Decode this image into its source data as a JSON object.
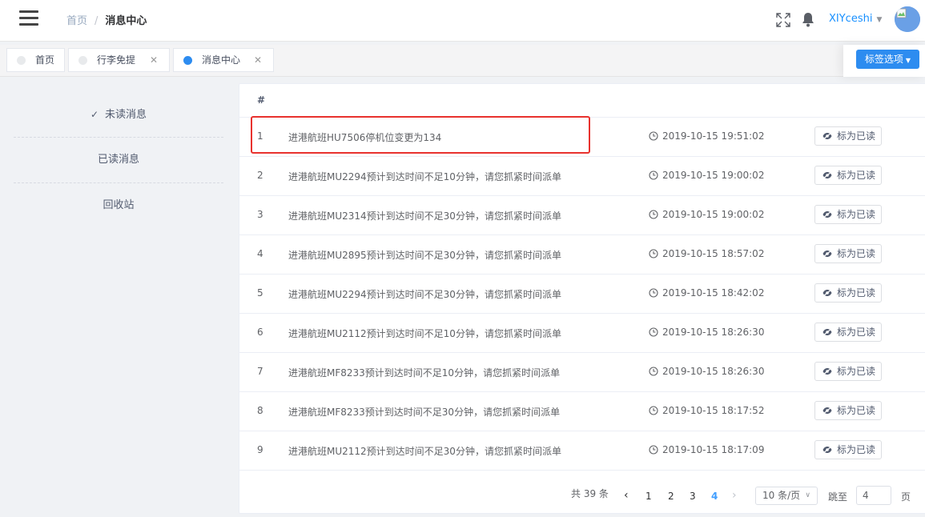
{
  "breadcrumb": {
    "home": "首页",
    "separator": "/",
    "current": "消息中心"
  },
  "user": {
    "name": "XIYceshi"
  },
  "tags": [
    {
      "label": "首页",
      "active": false,
      "closable": false
    },
    {
      "label": "行李免提",
      "active": false,
      "closable": true
    },
    {
      "label": "消息中心",
      "active": true,
      "closable": true
    }
  ],
  "tag_close_glyph": "✕",
  "tag_options_label": "标签选项",
  "side_menu": [
    {
      "label": "未读消息",
      "selected": true
    },
    {
      "label": "已读消息",
      "selected": false
    },
    {
      "label": "回收站",
      "selected": false
    }
  ],
  "table": {
    "header_index": "#",
    "action_label": "标为已读",
    "rows": [
      {
        "index": "1",
        "message": "进港航班HU7506停机位变更为134",
        "time": "2019-10-15 19:51:02"
      },
      {
        "index": "2",
        "message": "进港航班MU2294预计到达时间不足10分钟，请您抓紧时间派单",
        "time": "2019-10-15 19:00:02"
      },
      {
        "index": "3",
        "message": "进港航班MU2314预计到达时间不足30分钟，请您抓紧时间派单",
        "time": "2019-10-15 19:00:02"
      },
      {
        "index": "4",
        "message": "进港航班MU2895预计到达时间不足30分钟，请您抓紧时间派单",
        "time": "2019-10-15 18:57:02"
      },
      {
        "index": "5",
        "message": "进港航班MU2294预计到达时间不足30分钟，请您抓紧时间派单",
        "time": "2019-10-15 18:42:02"
      },
      {
        "index": "6",
        "message": "进港航班MU2112预计到达时间不足10分钟，请您抓紧时间派单",
        "time": "2019-10-15 18:26:30"
      },
      {
        "index": "7",
        "message": "进港航班MF8233预计到达时间不足10分钟，请您抓紧时间派单",
        "time": "2019-10-15 18:26:30"
      },
      {
        "index": "8",
        "message": "进港航班MF8233预计到达时间不足30分钟，请您抓紧时间派单",
        "time": "2019-10-15 18:17:52"
      },
      {
        "index": "9",
        "message": "进港航班MU2112预计到达时间不足30分钟，请您抓紧时间派单",
        "time": "2019-10-15 18:17:09"
      }
    ]
  },
  "pagination": {
    "total_label": "共 39 条",
    "pages": [
      "1",
      "2",
      "3",
      "4"
    ],
    "current_page": "4",
    "page_size": "10 条/页",
    "jump_label": "跳至",
    "jump_value": "4",
    "jump_unit": "页"
  },
  "colors": {
    "primary": "#2d8cf0",
    "highlight_border": "#e8322e",
    "link": "#409eff"
  }
}
